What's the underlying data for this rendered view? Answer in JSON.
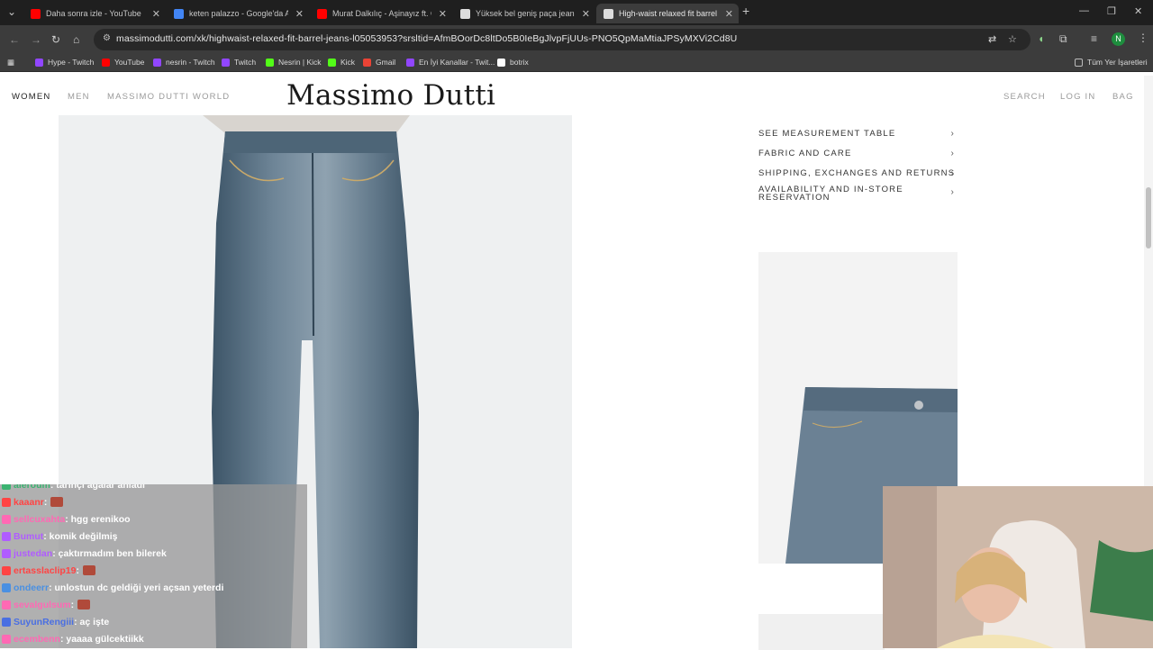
{
  "browser": {
    "tabs": [
      {
        "title": "Daha sonra izle - YouTube",
        "icon": "youtube-icon",
        "color": "#ff0000",
        "active": false
      },
      {
        "title": "keten palazzo - Google'da Ara",
        "icon": "google-icon",
        "color": "#4285f4",
        "active": false
      },
      {
        "title": "Murat Dalkılıç - Aşinayız ft. Oğ",
        "icon": "youtube-icon",
        "color": "#ff0000",
        "active": false
      },
      {
        "title": "Yüksek bel geniş paça jean - Ma",
        "icon": "page-icon",
        "color": "#dddddd",
        "active": false
      },
      {
        "title": "High-waist relaxed fit barrel jea",
        "icon": "page-icon",
        "color": "#dddddd",
        "active": true
      }
    ],
    "url": "massimodutti.com/xk/highwaist-relaxed-fit-barrel-jeans-l05053953?srsltid=AfmBOorDc8ltDo5B0IeBgJlvpFjUUs-PNO5QpMaMtiaJPSyMXVi2Cd8U",
    "profile_initial": "N",
    "bookmarks": [
      {
        "label": "Hype - Twitch",
        "color": "#9146ff"
      },
      {
        "label": "YouTube",
        "color": "#ff0000"
      },
      {
        "label": "nesrin - Twitch",
        "color": "#9146ff"
      },
      {
        "label": "Twitch",
        "color": "#9146ff"
      },
      {
        "label": "Nesrin | Kick",
        "color": "#53fc18"
      },
      {
        "label": "Kick",
        "color": "#53fc18"
      },
      {
        "label": "Gmail",
        "color": "#ea4335"
      },
      {
        "label": "En İyi Kanallar - Twit...",
        "color": "#9146ff"
      },
      {
        "label": "botrix",
        "color": "#ffffff"
      }
    ],
    "all_bookmarks": "Tüm Yer İşaretleri"
  },
  "site": {
    "nav_left": [
      "WOMEN",
      "MEN",
      "MASSIMO DUTTI WORLD"
    ],
    "logo": "Massimo Dutti",
    "nav_right": [
      "SEARCH",
      "LOG IN",
      "BAG"
    ],
    "accordion": [
      "SEE MEASUREMENT TABLE",
      "FABRIC AND CARE",
      "SHIPPING, EXCHANGES AND RETURNS",
      "AVAILABILITY AND IN-STORE RESERVATION"
    ]
  },
  "chat": [
    {
      "user": "aleroum",
      "msg": ": tarihçi ağalar anladı",
      "color": "#3cb371"
    },
    {
      "user": "kaaanr",
      "msg": ":",
      "color": "#ff4444",
      "emote": true
    },
    {
      "user": "sellcuxahta",
      "msg": ": hgg erenikoo",
      "color": "#ff69b4"
    },
    {
      "user": "Bumut",
      "msg": ": komik değilmiş",
      "color": "#b05cff"
    },
    {
      "user": "justedan",
      "msg": ": çaktırmadım ben bilerek",
      "color": "#b05cff"
    },
    {
      "user": "ertasslaclip19",
      "msg": ":",
      "color": "#ff4444",
      "emote": true
    },
    {
      "user": "ondeerr",
      "msg": ": unlostun dc geldiği yeri açsan yeterdi",
      "color": "#4a90e2"
    },
    {
      "user": "sevalgulsum",
      "msg": ":",
      "color": "#ff69b4",
      "emote": true
    },
    {
      "user": "SuyunRengiii",
      "msg": ": aç işte",
      "color": "#4a6fe2"
    },
    {
      "user": "ecembenn",
      "msg": ": yaaaa gülcektiikk",
      "color": "#ff69b4"
    }
  ]
}
